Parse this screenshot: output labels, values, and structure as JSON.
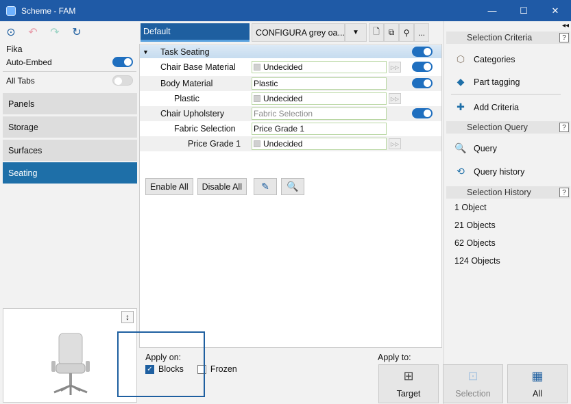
{
  "window": {
    "title": "Scheme - FAM",
    "controls": {
      "minimize": "—",
      "maximize": "☐",
      "close": "✕"
    }
  },
  "left": {
    "toolbar": [
      {
        "name": "search-scheme-icon",
        "glyph": "⊙"
      },
      {
        "name": "undo-icon",
        "glyph": "↶"
      },
      {
        "name": "redo-icon",
        "glyph": "↷"
      },
      {
        "name": "refresh-icon",
        "glyph": "↻"
      }
    ],
    "scheme_name": "Fika",
    "auto_embed_label": "Auto-Embed",
    "auto_embed_on": true,
    "all_tabs_label": "All Tabs",
    "all_tabs_on": false,
    "categories": [
      "Panels",
      "Storage",
      "Surfaces",
      "Seating"
    ],
    "active_category": "Seating",
    "preview_resize_glyph": "↕"
  },
  "center": {
    "tab_default": "Default",
    "tab_dropdown": "CONFIGURA grey oa...",
    "tab_arrow": "▼",
    "tools": [
      "🗋",
      "⧉",
      "⚲",
      "..."
    ],
    "group": {
      "caret": "▼",
      "label": "Task Seating"
    },
    "rows": [
      {
        "label": "Chair Base Material",
        "value": "Undecided",
        "swatch": true
      },
      {
        "label": "Body Material",
        "value": "Plastic",
        "swatch": false
      },
      {
        "label": "Plastic",
        "value": "Undecided",
        "swatch": true
      },
      {
        "label": "Chair Upholstery",
        "value": "Fabric Selection",
        "swatch": false
      },
      {
        "label": "Fabric Selection",
        "value": "Price Grade 1",
        "swatch": false
      },
      {
        "label": "Price Grade 1",
        "value": "Undecided",
        "swatch": true
      }
    ],
    "row_btn_glyph": "▷▷",
    "buttons": {
      "enable_all": "Enable All",
      "disable_all": "Disable All",
      "picker_glyph": "✎",
      "search_glyph": "🔍"
    },
    "apply_on_label": "Apply on:",
    "blocks_label": "Blocks",
    "blocks_checked": true,
    "frozen_label": "Frozen",
    "frozen_checked": false,
    "check_glyph": "✓"
  },
  "right": {
    "collapse_glyph": "◂◂",
    "help_glyph": "?",
    "selection_criteria": "Selection Criteria",
    "categories": "Categories",
    "part_tagging": "Part tagging",
    "add_criteria": "Add Criteria",
    "selection_query": "Selection Query",
    "query": "Query",
    "query_history": "Query history",
    "selection_history": "Selection History",
    "history": [
      "1 Object",
      "21 Objects",
      "62 Objects",
      "124 Objects"
    ],
    "icons": {
      "categories": "⬡",
      "part_tagging": "◆",
      "add_criteria": "✚",
      "query": "🔍",
      "query_history": "⟲"
    }
  },
  "apply_to": {
    "label": "Apply to:",
    "target": "Target",
    "selection": "Selection",
    "all": "All",
    "target_glyph": "⊞",
    "selection_glyph": "⊡",
    "all_glyph": "▦"
  },
  "colors": {
    "titlebar": "#1f5aa6",
    "accent": "#1e6fa8",
    "highlight": "#1e5fa0"
  }
}
